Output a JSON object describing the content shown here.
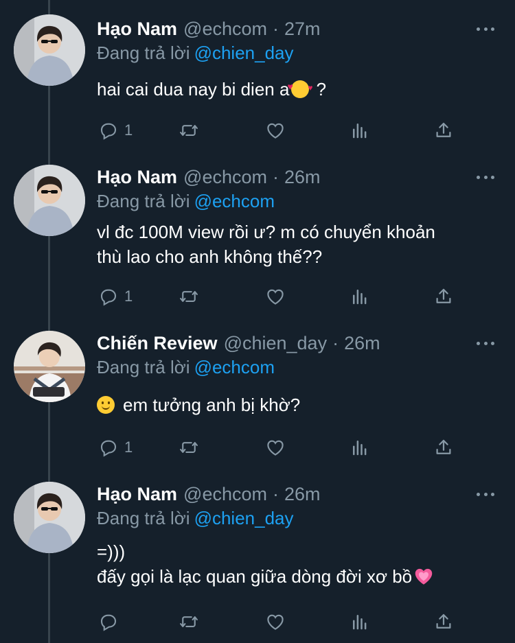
{
  "tweets": [
    {
      "name": "Hạo Nam",
      "handle": "@echcom",
      "time": "27m",
      "reply_prefix": "Đang trả lời",
      "reply_to": "@chien_day",
      "lines": [
        "hai cai dua nay bi dien a",
        " ?"
      ],
      "reply_count": "1",
      "avatar": "hao-nam-avatar"
    },
    {
      "name": "Hạo Nam",
      "handle": "@echcom",
      "time": "26m",
      "reply_prefix": "Đang trả lời",
      "reply_to": "@echcom",
      "lines": [
        "vl đc 100M view rồi ư? m có chuyển khoản",
        "thù lao cho anh không thế??"
      ],
      "reply_count": "1",
      "avatar": "hao-nam-avatar"
    },
    {
      "name": "Chiến Review",
      "handle": "@chien_day",
      "time": "26m",
      "reply_prefix": "Đang trả lời",
      "reply_to": "@echcom",
      "lines": [
        "em tưởng anh bị khờ?"
      ],
      "reply_count": "1",
      "avatar": "chien-review-avatar"
    },
    {
      "name": "Hạo Nam",
      "handle": "@echcom",
      "time": "26m",
      "reply_prefix": "Đang trả lời",
      "reply_to": "@chien_day",
      "lines": [
        "=)))",
        "đấy gọi là lạc quan giữa dòng đời xơ bồ"
      ],
      "reply_count": "",
      "avatar": "hao-nam-avatar"
    }
  ],
  "icons": [
    "reply-icon",
    "retweet-icon",
    "like-icon",
    "analytics-icon",
    "share-icon",
    "more-icon"
  ],
  "colors": {
    "background": "#15202b",
    "secondary_text": "#8899a6",
    "mention": "#1da1f2",
    "thread_line": "#38444d"
  }
}
